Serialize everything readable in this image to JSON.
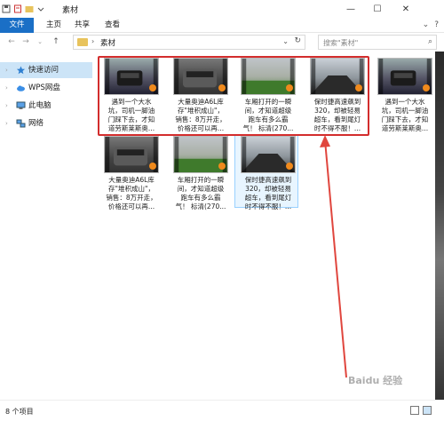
{
  "window": {
    "title": "素材",
    "quick_access_icons": [
      "save-icon",
      "properties-icon",
      "folder-icon",
      "dropdown-icon"
    ]
  },
  "ribbon": {
    "tabs": [
      {
        "label": "文件"
      },
      {
        "label": "主页"
      },
      {
        "label": "共享"
      },
      {
        "label": "查看"
      }
    ]
  },
  "nav": {
    "path": "素材",
    "search_placeholder": "搜索\"素材\""
  },
  "sidebar": {
    "items": [
      {
        "label": "快速访问",
        "icon": "star-icon"
      },
      {
        "label": "WPS网盘",
        "icon": "cloud-icon"
      },
      {
        "label": "此电脑",
        "icon": "computer-icon"
      },
      {
        "label": "网络",
        "icon": "network-icon"
      }
    ]
  },
  "files": [
    {
      "caption": "遇到一个大水\n坑，司机一脚油\n门踩下去，才知\n道劳斯莱斯奥..."
    },
    {
      "caption": "大量奥迪A6L库\n存\"堆积成山\"，\n销售：8万开走，\n价格还可以再..."
    },
    {
      "caption": "车厢打开的一瞬\n间，才知道超级\n跑车有多么霸\n气！ 标清(270..."
    },
    {
      "caption": "保时捷高速飙到\n320，却被轻易\n超车，看到尾灯\n时不得不服！..."
    },
    {
      "caption": "遇到一个大水\n坑，司机一脚油\n门踩下去，才知\n道劳斯莱斯奥..."
    },
    {
      "caption": "大量奥迪A6L库\n存\"堆积成山\"，\n销售：8万开走，\n价格还可以再..."
    },
    {
      "caption": "车厢打开的一瞬\n间，才知道超级\n跑车有多么霸\n气！ 标清(270..."
    },
    {
      "caption": "保时捷高速飙到\n320，却被轻易\n超车，看到尾灯\n时不得不服！..."
    }
  ],
  "status": {
    "count": "8 个项目"
  },
  "watermark": "Baidu 经验",
  "colors": {
    "accent": "#1a6fc6",
    "selection_box": "#d32d2d",
    "annotation_arrow": "#e0463e"
  }
}
